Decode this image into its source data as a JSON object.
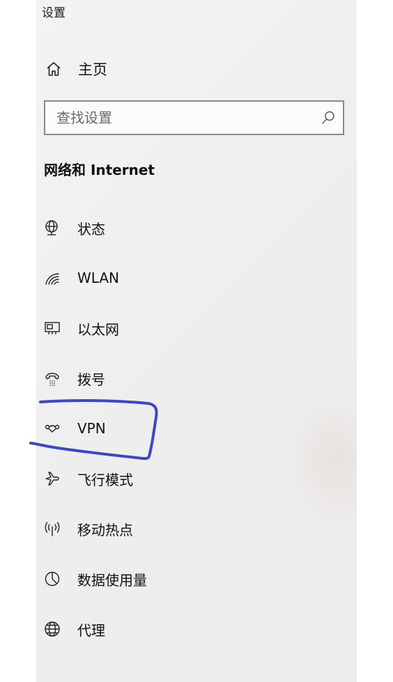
{
  "window": {
    "title": "设置"
  },
  "home": {
    "label": "主页",
    "icon": "home-icon"
  },
  "search": {
    "placeholder": "查找设置",
    "value": "",
    "icon": "search-icon"
  },
  "section": {
    "title": "网络和 Internet"
  },
  "nav": {
    "items": [
      {
        "label": "状态",
        "icon": "network-status-icon"
      },
      {
        "label": "WLAN",
        "icon": "wifi-icon"
      },
      {
        "label": "以太网",
        "icon": "ethernet-icon"
      },
      {
        "label": "拨号",
        "icon": "dialup-icon"
      },
      {
        "label": "VPN",
        "icon": "vpn-icon"
      },
      {
        "label": "飞行模式",
        "icon": "airplane-icon"
      },
      {
        "label": "移动热点",
        "icon": "hotspot-icon"
      },
      {
        "label": "数据使用量",
        "icon": "data-usage-icon"
      },
      {
        "label": "代理",
        "icon": "globe-icon"
      }
    ]
  },
  "annotation": {
    "color": "#3b46c8",
    "target": "VPN"
  }
}
